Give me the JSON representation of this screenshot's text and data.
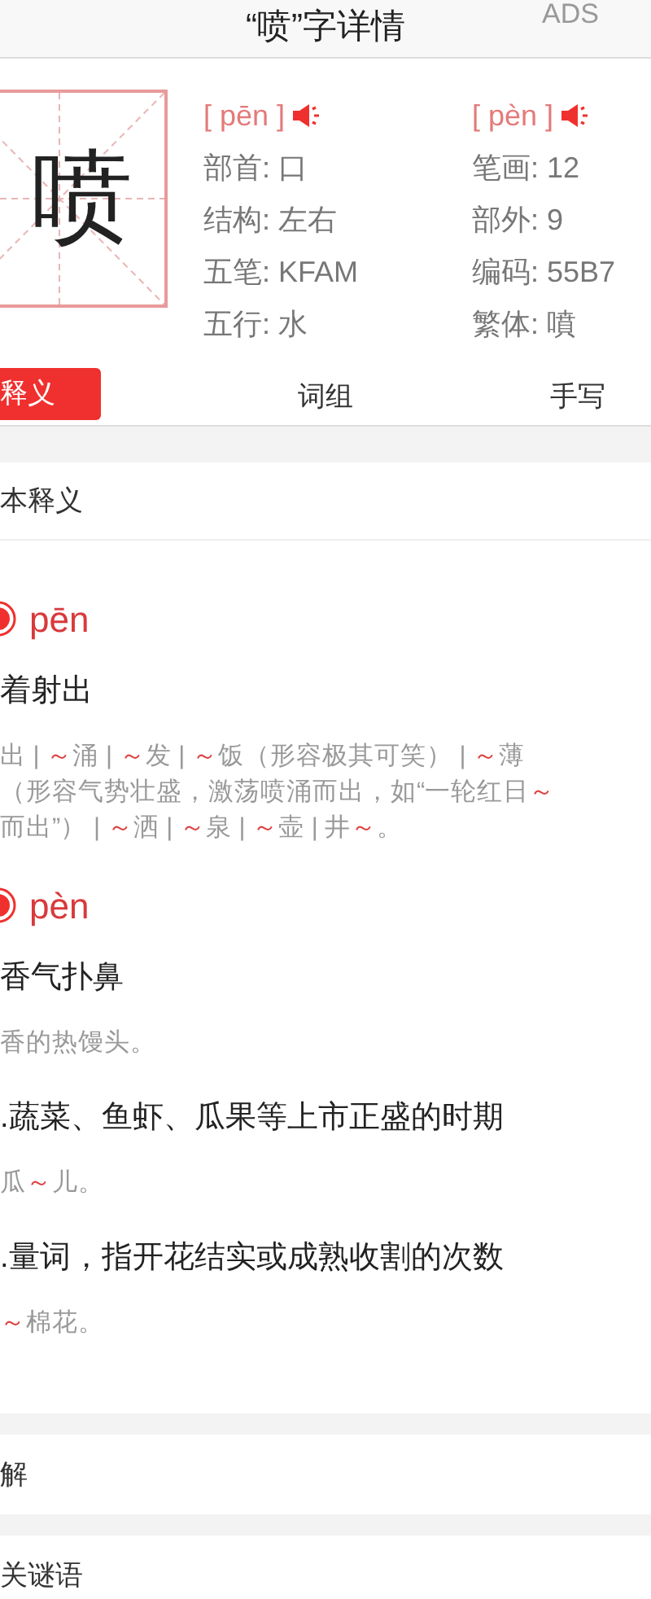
{
  "header": {
    "title": "“喷”字详情",
    "action": "ADS"
  },
  "character": "喷",
  "info": {
    "pinyin": [
      "[ pēn ]",
      "[ pèn ]"
    ],
    "left": [
      "部首: 口",
      "结构: 左右",
      "五笔: KFAM",
      "五行: 水"
    ],
    "right": [
      "笔画: 12",
      "部外: 9",
      "编码: 55B7",
      "繁体: 噴"
    ]
  },
  "tabs": [
    {
      "label": "释义",
      "selected": true
    },
    {
      "label": "词组",
      "selected": false
    },
    {
      "label": "手写",
      "selected": false
    }
  ],
  "section_title": "本释义",
  "readings": [
    {
      "pinyin": "pēn",
      "senses": [
        {
          "definition": "着射出",
          "example_lines": [
            [
              {
                "text": "出 | ",
                "red": false
              },
              {
                "text": "～",
                "red": true
              },
              {
                "text": "涌 | ",
                "red": false
              },
              {
                "text": "～",
                "red": true
              },
              {
                "text": "发 | ",
                "red": false
              },
              {
                "text": "～",
                "red": true
              },
              {
                "text": "饭（形容极其可笑） | ",
                "red": false
              },
              {
                "text": "～",
                "red": true
              },
              {
                "text": "薄",
                "red": false
              }
            ],
            [
              {
                "text": "（形容气势壮盛，激荡喷涌而出，如“一轮红日",
                "red": false
              },
              {
                "text": "～",
                "red": true
              }
            ],
            [
              {
                "text": "而出”） | ",
                "red": false
              },
              {
                "text": "～",
                "red": true
              },
              {
                "text": "洒 | ",
                "red": false
              },
              {
                "text": "～",
                "red": true
              },
              {
                "text": "泉 | ",
                "red": false
              },
              {
                "text": "～",
                "red": true
              },
              {
                "text": "壶 | 井",
                "red": false
              },
              {
                "text": "～",
                "red": true
              },
              {
                "text": "。",
                "red": false
              }
            ]
          ]
        }
      ]
    },
    {
      "pinyin": "pèn",
      "senses": [
        {
          "definition": "香气扑鼻",
          "example_lines": [
            [
              {
                "text": "香的热馒头。",
                "red": false
              }
            ]
          ]
        },
        {
          "definition": ".蔬菜、鱼虾、瓜果等上市正盛的时期",
          "example_lines": [
            [
              {
                "text": "瓜",
                "red": false
              },
              {
                "text": "～",
                "red": true
              },
              {
                "text": "儿。",
                "red": false
              }
            ]
          ]
        },
        {
          "definition": ".量词，指开花结实或成熟收割的次数",
          "example_lines": [
            [
              {
                "text": "～",
                "red": true
              },
              {
                "text": "棉花。",
                "red": false
              }
            ]
          ]
        }
      ]
    }
  ],
  "bottom_sections": [
    "解",
    "关谜语"
  ]
}
